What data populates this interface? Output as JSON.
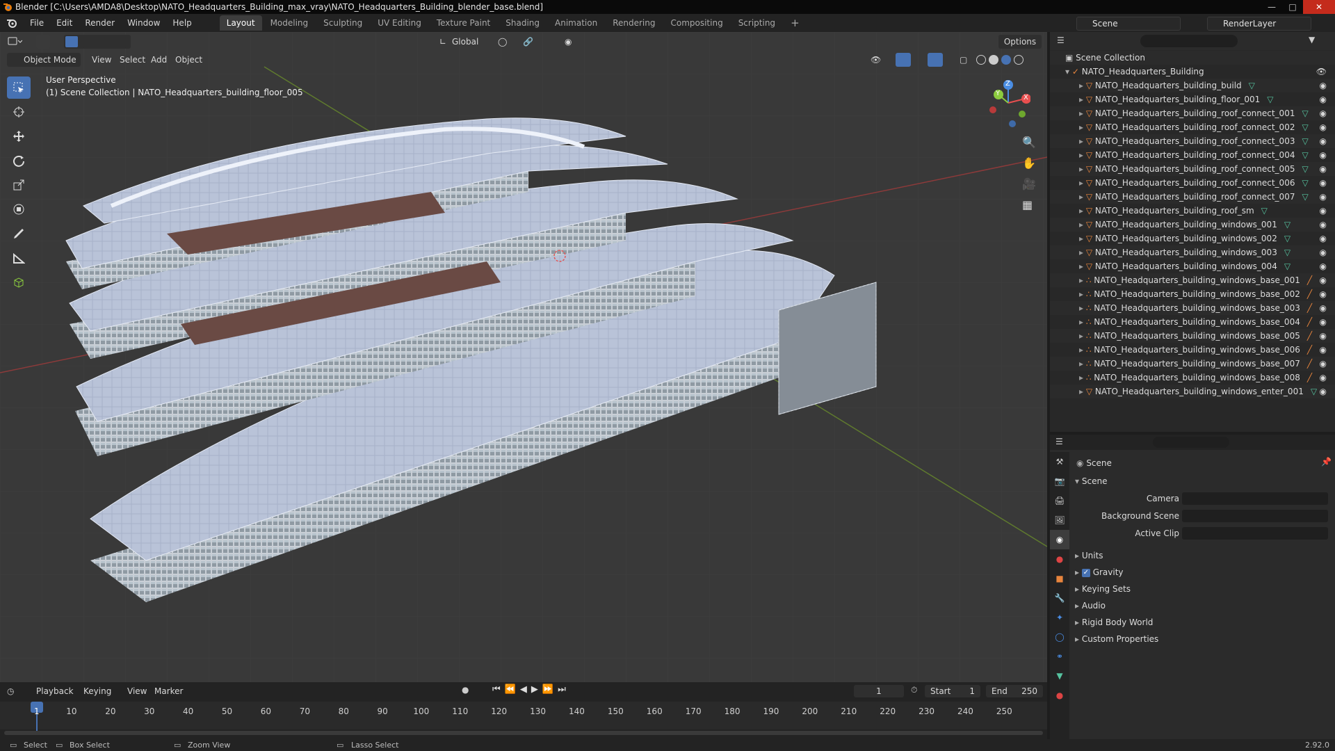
{
  "titlebar": {
    "title": "Blender [C:\\Users\\AMDA8\\Desktop\\NATO_Headquarters_Building_max_vray\\NATO_Headquarters_Building_blender_base.blend]"
  },
  "menu": [
    "File",
    "Edit",
    "Render",
    "Window",
    "Help"
  ],
  "workspaces": [
    {
      "label": "Layout",
      "active": true
    },
    {
      "label": "Modeling"
    },
    {
      "label": "Sculpting"
    },
    {
      "label": "UV Editing"
    },
    {
      "label": "Texture Paint"
    },
    {
      "label": "Shading"
    },
    {
      "label": "Animation"
    },
    {
      "label": "Rendering"
    },
    {
      "label": "Compositing"
    },
    {
      "label": "Scripting"
    }
  ],
  "scene_field": "Scene",
  "renderlayer_field": "RenderLayer",
  "viewport_header": {
    "transform_orientation": "Global",
    "options_label": "Options",
    "mode": "Object Mode",
    "menus": [
      "View",
      "Select",
      "Add",
      "Object"
    ]
  },
  "overlay_text": {
    "perspective": "User Perspective",
    "collection": "(1) Scene Collection | NATO_Headquarters_building_floor_005"
  },
  "gizmo": {
    "x": "X",
    "y": "Y",
    "z": "Z"
  },
  "outliner": {
    "root": "Scene Collection",
    "collection": "NATO_Headquarters_Building",
    "items": [
      {
        "name": "NATO_Headquarters_building_build",
        "kind": "mesh"
      },
      {
        "name": "NATO_Headquarters_building_floor_001",
        "kind": "mesh"
      },
      {
        "name": "NATO_Headquarters_building_roof_connect_001",
        "kind": "mesh"
      },
      {
        "name": "NATO_Headquarters_building_roof_connect_002",
        "kind": "mesh"
      },
      {
        "name": "NATO_Headquarters_building_roof_connect_003",
        "kind": "mesh"
      },
      {
        "name": "NATO_Headquarters_building_roof_connect_004",
        "kind": "mesh"
      },
      {
        "name": "NATO_Headquarters_building_roof_connect_005",
        "kind": "mesh"
      },
      {
        "name": "NATO_Headquarters_building_roof_connect_006",
        "kind": "mesh"
      },
      {
        "name": "NATO_Headquarters_building_roof_connect_007",
        "kind": "mesh"
      },
      {
        "name": "NATO_Headquarters_building_roof_sm",
        "kind": "mesh"
      },
      {
        "name": "NATO_Headquarters_building_windows_001",
        "kind": "mesh"
      },
      {
        "name": "NATO_Headquarters_building_windows_002",
        "kind": "mesh"
      },
      {
        "name": "NATO_Headquarters_building_windows_003",
        "kind": "mesh"
      },
      {
        "name": "NATO_Headquarters_building_windows_004",
        "kind": "mesh"
      },
      {
        "name": "NATO_Headquarters_building_windows_base_001",
        "kind": "curve"
      },
      {
        "name": "NATO_Headquarters_building_windows_base_002",
        "kind": "curve"
      },
      {
        "name": "NATO_Headquarters_building_windows_base_003",
        "kind": "curve"
      },
      {
        "name": "NATO_Headquarters_building_windows_base_004",
        "kind": "curve"
      },
      {
        "name": "NATO_Headquarters_building_windows_base_005",
        "kind": "curve"
      },
      {
        "name": "NATO_Headquarters_building_windows_base_006",
        "kind": "curve"
      },
      {
        "name": "NATO_Headquarters_building_windows_base_007",
        "kind": "curve"
      },
      {
        "name": "NATO_Headquarters_building_windows_base_008",
        "kind": "curve"
      },
      {
        "name": "NATO_Headquarters_building_windows_enter_001",
        "kind": "mesh"
      }
    ]
  },
  "properties": {
    "header": "Scene",
    "panel": "Scene",
    "fields": [
      {
        "label": "Camera"
      },
      {
        "label": "Background Scene"
      },
      {
        "label": "Active Clip"
      }
    ],
    "sections": [
      {
        "label": "Units"
      },
      {
        "label": "Gravity",
        "checkbox": true
      },
      {
        "label": "Keying Sets"
      },
      {
        "label": "Audio"
      },
      {
        "label": "Rigid Body World"
      },
      {
        "label": "Custom Properties"
      }
    ]
  },
  "timeline": {
    "menus": [
      "Playback",
      "Keying",
      "View",
      "Marker"
    ],
    "current_frame": "1",
    "start_label": "Start",
    "start": "1",
    "end_label": "End",
    "end": "250",
    "ticks": [
      "1",
      "10",
      "20",
      "30",
      "40",
      "50",
      "60",
      "70",
      "80",
      "90",
      "100",
      "110",
      "120",
      "130",
      "140",
      "150",
      "160",
      "170",
      "180",
      "190",
      "200",
      "210",
      "220",
      "230",
      "240",
      "250"
    ]
  },
  "statusbar": {
    "select": "Select",
    "box_select": "Box Select",
    "zoom_view": "Zoom View",
    "lasso_select": "Lasso Select",
    "version": "2.92.0"
  },
  "colors": {
    "accent": "#4772b3",
    "x_axis": "#e94f4f",
    "y_axis": "#8ccc3e",
    "z_axis": "#4a8de4",
    "eye": "#d8d8d8",
    "mesh_icon": "#e8853d",
    "data_icon": "#56c4a0"
  }
}
